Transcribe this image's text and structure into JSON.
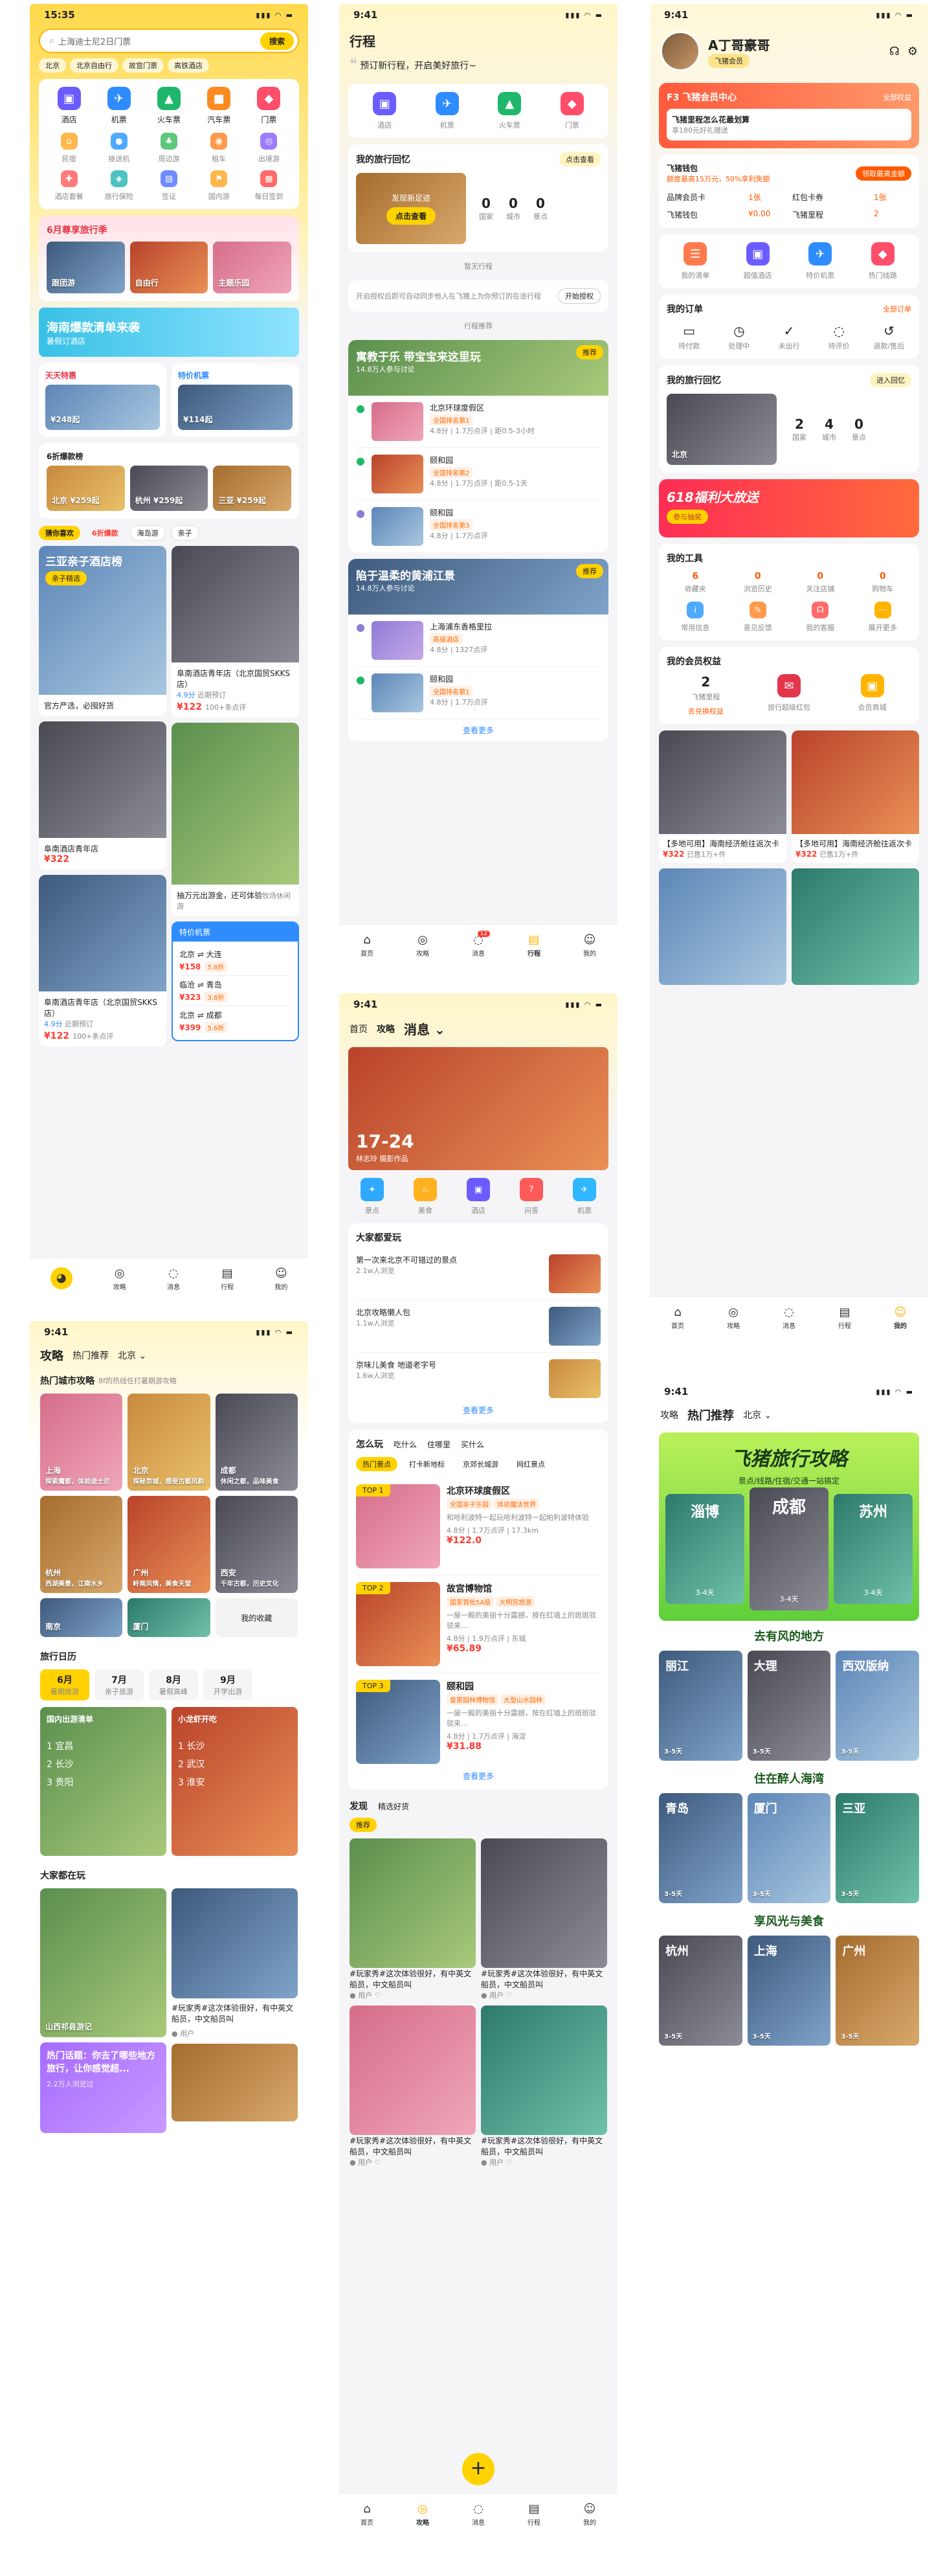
{
  "home": {
    "time": "15:35",
    "search_placeholder": "上海迪士尼2日门票",
    "search_btn": "搜索",
    "quick_tags": [
      "北京",
      "北京自由行",
      "故宫门票",
      "高铁酒店"
    ],
    "main_icons": [
      {
        "label": "酒店",
        "color": "#6a5cff"
      },
      {
        "label": "机票",
        "color": "#2f8cff"
      },
      {
        "label": "火车票",
        "color": "#1fb86a"
      },
      {
        "label": "汽车票",
        "color": "#ff8a1f"
      },
      {
        "label": "门票",
        "color": "#ff4d6a"
      }
    ],
    "sub_icons": [
      "民宿",
      "接送机",
      "周边游",
      "租车",
      "出境游",
      "酒店套餐",
      "旅行保险",
      "签证",
      "国内游",
      "每日签到"
    ],
    "promo_title": "6月尊享旅行季",
    "promo_items": [
      "跟团游",
      "自由行",
      "主题乐园"
    ],
    "banner_text": "海南爆款清单来袭",
    "banner_sub": "暑假订酒店",
    "deal_left_title": "天天特惠",
    "deal_left_sub": "¥248起",
    "deal_right_title": "特价机票",
    "deal_right_sub": "¥114起",
    "hotel_rank_title": "6折爆款榜",
    "hotel_rank": [
      {
        "name": "北京",
        "price": "¥259起"
      },
      {
        "name": "杭州",
        "price": "¥259起"
      },
      {
        "name": "三亚",
        "price": "¥259起"
      }
    ],
    "feed_tabs": [
      "猜你喜欢",
      "6折爆款",
      "海岛游",
      "亲子"
    ],
    "feed": [
      {
        "title": "三亚亲子酒店榜",
        "desc": "官方严选，必囤好货",
        "sub": "亲子精选"
      },
      {
        "title": "阜南酒店青年店（北京国贸SKKS店）",
        "score": "4.9分",
        "note": "近期预订",
        "price": "¥122",
        "sold": "100+条点评"
      },
      {
        "title": "阜南酒店青年店",
        "price": "¥322"
      },
      {
        "title": "抽万元出游金，还可体验",
        "desc": "牧场休闲游"
      },
      {
        "title": "阜南酒店青年店（北京国贸SKKS店）",
        "score": "4.9分",
        "note": "近期预订",
        "price": "¥122",
        "sold": "100+条点评"
      }
    ],
    "flights_title": "特价机票",
    "flights": [
      {
        "route": "北京 ⇌ 大连",
        "price": "¥158",
        "tag": "5.8折"
      },
      {
        "route": "临沧 ⇌ 青岛",
        "price": "¥323",
        "tag": "3.8折"
      },
      {
        "route": "北京 ⇌ 成都",
        "price": "¥399",
        "tag": "5.6折"
      }
    ],
    "tabs": [
      "",
      "攻略",
      "消息",
      "行程",
      "我的"
    ]
  },
  "trip": {
    "time": "9:41",
    "title": "行程",
    "hint": "预订新行程，开启美好旅行~",
    "icons": [
      "酒店",
      "机票",
      "火车票",
      "门票"
    ],
    "memory_title": "我的旅行回忆",
    "memory_btn": "点击查看",
    "memory_card": "发现新足迹",
    "memory_card_btn": "点击查看",
    "stats": [
      {
        "value": "0",
        "label": "国家"
      },
      {
        "value": "0",
        "label": "城市"
      },
      {
        "value": "0",
        "label": "景点"
      }
    ],
    "empty_label": "暂无行程",
    "auth_text": "开启授权后即可自动同步他人在飞猪上为你预订的在途行程",
    "auth_btn": "开始授权",
    "recommend_label": "行程推荐",
    "rec1_title": "寓教于乐 带宝宝来这里玩",
    "rec1_sub": "14.8万人参与讨论",
    "rec1_tag": "推荐",
    "rec1_items": [
      {
        "name": "北京环球度假区",
        "tag": "全国排名第1",
        "score": "4.8分",
        "reviews": "1.7万点评",
        "dist": "距0.5-3小时"
      },
      {
        "name": "颐和园",
        "tag": "全国排名第2",
        "score": "4.8分",
        "reviews": "1.7万点评",
        "dist": "距0.5-1天"
      },
      {
        "name": "颐和园",
        "tag": "全国排名第3",
        "score": "4.8分",
        "reviews": "1.7万点评",
        "dist": ""
      }
    ],
    "rec2_title": "陷于温柔的黄浦江景",
    "rec2_sub": "14.8万人参与讨论",
    "rec2_tag": "推荐",
    "rec2_items": [
      {
        "name": "上海浦东香格里拉",
        "tag": "高级酒店",
        "score": "4.8分",
        "reviews": "1327点评"
      },
      {
        "name": "颐和园",
        "tag": "全国排名第1",
        "score": "4.8分",
        "reviews": "1.7万点评"
      }
    ],
    "more": "查看更多",
    "tabs": [
      "首页",
      "攻略",
      "消息",
      "行程",
      "我的"
    ],
    "badge": "12"
  },
  "mine": {
    "time": "9:41",
    "username": "A丁哥豪哥",
    "level": "飞猪会员",
    "member_card": "F3 飞猪会员中心",
    "member_link": "全部权益",
    "member_tip": "飞猪里程怎么花最划算",
    "member_tip_sub": "享180元好礼赠送",
    "wallet_title": "飞猪钱包",
    "wallet_sub": "额度最高15万元，50%享利免额",
    "wallet_btn": "领取最高金额",
    "wallet_rows": [
      [
        "品牌会员卡",
        "1张",
        "红包卡券",
        "1张"
      ],
      [
        "飞猪钱包",
        "¥0.00",
        "飞猪里程",
        "2"
      ]
    ],
    "quick": [
      "我的清单",
      "超值酒店",
      "特价机票",
      "热门线路"
    ],
    "orders_title": "我的订单",
    "orders_link": "全部订单",
    "orders": [
      "待付款",
      "处理中",
      "未出行",
      "待评价",
      "退款/售后"
    ],
    "memory_title": "我的旅行回忆",
    "memory_link": "进入回忆",
    "memory_stats": [
      {
        "value": "2",
        "label": "国家"
      },
      {
        "value": "4",
        "label": "城市"
      },
      {
        "value": "0",
        "label": "景点"
      }
    ],
    "memory_place": "北京",
    "banner_title": "618福利大放送",
    "banner_btn": "参与抽奖",
    "tools_title": "我的工具",
    "tools_stats": [
      {
        "value": "6",
        "label": "收藏夹"
      },
      {
        "value": "0",
        "label": "浏览历史"
      },
      {
        "value": "0",
        "label": "关注店铺"
      },
      {
        "value": "0",
        "label": "购物车"
      }
    ],
    "tools": [
      "常用信息",
      "意见反馈",
      "我的客服",
      "展开更多"
    ],
    "vip_title": "我的会员权益",
    "vip_items": [
      {
        "label": "飞猪里程",
        "value": "2"
      },
      {
        "label": "旅行超级红包",
        "value": ""
      },
      {
        "label": "会员商城",
        "value": ""
      }
    ],
    "vip_link": "去兑换权益",
    "products": [
      {
        "title": "【多地可用】海南经济舱往返次卡",
        "price": "¥322",
        "note": "已售1万+件"
      },
      {
        "title": "【多地可用】海南经济舱往返次卡",
        "price": "¥322",
        "note": "已售1万+件"
      }
    ],
    "tabs": [
      "首页",
      "攻略",
      "消息",
      "行程",
      "我的"
    ]
  },
  "guide": {
    "time": "9:41",
    "tabs": [
      "攻略",
      "热门推荐",
      "北京"
    ],
    "hot_title": "热门城市攻略",
    "hot_sub": "8f的热线任打暑期游攻略",
    "cities": [
      {
        "name": "上海",
        "desc": "探索魔都，体验迪士尼"
      },
      {
        "name": "北京",
        "desc": "探秘京城，感受古都风韵"
      },
      {
        "name": "成都",
        "desc": "休闲之都，品味美食"
      },
      {
        "name": "杭州",
        "desc": "西湖美景，江南水乡"
      },
      {
        "name": "广州",
        "desc": "岭南风情，美食天堂"
      },
      {
        "name": "西安",
        "desc": "千年古都，历史文化"
      },
      {
        "name": "南京",
        "desc": "六朝古都"
      },
      {
        "name": "厦门",
        "desc": "海上花园"
      },
      {
        "name": "我的收藏",
        "desc": ""
      }
    ],
    "cal_title": "旅行日历",
    "months": [
      {
        "m": "6月",
        "s": "暑期旅游"
      },
      {
        "m": "7月",
        "s": "亲子旅游"
      },
      {
        "m": "8月",
        "s": "暑假高峰"
      },
      {
        "m": "9月",
        "s": "开学出游"
      }
    ],
    "cal_cards": [
      {
        "title": "国内出游清单",
        "items": [
          "宜昌",
          "长沙",
          "贵阳"
        ]
      },
      {
        "title": "小龙虾开吃",
        "items": [
          "长沙",
          "武汉",
          "淮安"
        ]
      }
    ],
    "play_title": "大家都在玩",
    "plays": [
      {
        "title": "山西祁县游记",
        "user": "用户"
      },
      {
        "title": "#玩家秀#这次体验很好，有中英文船员，中文船员叫",
        "user": "用户"
      }
    ],
    "question": "热门话题：你去了哪些地方旅行，让你感觉超...",
    "question_sub": "2.2万人浏览过"
  },
  "beijing": {
    "time": "9:41",
    "tabs": [
      "首页",
      "攻略",
      "消息",
      "行程",
      "我的"
    ],
    "hero_date": "17-24",
    "hero_caption": "林志玲 摄影作品",
    "icons": [
      {
        "label": "景点",
        "color": "#2fa9ff"
      },
      {
        "label": "美食",
        "color": "#ffb21f"
      },
      {
        "label": "酒店",
        "color": "#6a5cff"
      },
      {
        "label": "问答",
        "color": "#ff5a5a"
      },
      {
        "label": "机票",
        "color": "#2fb8ff"
      }
    ],
    "love_title": "大家都爱玩",
    "loves": [
      {
        "title": "第一次来北京不可错过的景点",
        "sub": "2.1w人浏览"
      },
      {
        "title": "北京攻略懒人包",
        "sub": "1.1w人浏览"
      },
      {
        "title": "京味儿美食 地道老字号",
        "sub": "1.6w人浏览"
      }
    ],
    "more": "查看更多",
    "how_tabs": [
      "怎么玩",
      "吃什么",
      "住哪里",
      "买什么"
    ],
    "how_sub": [
      "热门景点",
      "打卡新地标",
      "京郊长城游",
      "网红景点"
    ],
    "spots": [
      {
        "rank": "TOP 1",
        "name": "北京环球度假区",
        "tags": [
          "全国亲子乐园",
          "体验魔法世界"
        ],
        "desc": "和哈利波特一起玩哈利波特一起帕利波特体验",
        "score": "4.8分",
        "reviews": "1.7万点评",
        "dist": "17.3km",
        "price": "¥122.0"
      },
      {
        "rank": "TOP 2",
        "name": "故宫博物馆",
        "tags": [
          "国家首批5A级",
          "大明宫旅游"
        ],
        "desc": "一屋一殿的美丽十分震撼，按在红墙上的斑斑驳驳来...",
        "score": "4.8分",
        "reviews": "1.9万点评",
        "dist": "东城",
        "price": "¥65.89"
      },
      {
        "rank": "TOP 3",
        "name": "颐和园",
        "tags": [
          "皇家园林博物馆",
          "大型山水园林"
        ],
        "desc": "一屋一殿的美丽十分震撼，按在红墙上的斑斑驳驳来...",
        "score": "4.8分",
        "reviews": "1.7万点评",
        "dist": "海淀",
        "price": "¥31.88"
      }
    ],
    "find_tabs": [
      "发现",
      "精选好货"
    ],
    "find_pill": "推荐",
    "posts": [
      {
        "title": "#玩家秀#这次体验很好，有中英文船员，中文船员叫",
        "user": "用户"
      },
      {
        "title": "#玩家秀#这次体验很好，有中英文船员，中文船员叫",
        "user": "用户"
      },
      {
        "title": "#玩家秀#这次体验很好，有中英文船员，中文船员叫",
        "user": "用户"
      },
      {
        "title": "#玩家秀#这次体验很好，有中英文船员，中文船员叫",
        "user": "用户"
      }
    ]
  },
  "poster": {
    "time": "9:41",
    "tabs": [
      "攻略",
      "热门推荐",
      "北京"
    ],
    "title": "飞猪旅行攻略",
    "sub": "景点/线路/住宿/交通一站搞定",
    "top3": [
      {
        "name": "淄博",
        "days": "3-4天"
      },
      {
        "name": "成都",
        "days": "3-4天"
      },
      {
        "name": "苏州",
        "days": "3-4天"
      }
    ],
    "sections": [
      {
        "title": "去有风的地方",
        "cities": [
          {
            "name": "丽江",
            "days": "3-5天"
          },
          {
            "name": "大理",
            "days": "3-5天"
          },
          {
            "name": "西双版纳",
            "days": "3-5天"
          }
        ]
      },
      {
        "title": "住在醉人海湾",
        "cities": [
          {
            "name": "青岛",
            "days": "3-5天"
          },
          {
            "name": "厦门",
            "days": "3-5天"
          },
          {
            "name": "三亚",
            "days": "3-5天"
          }
        ]
      },
      {
        "title": "享风光与美食",
        "cities": [
          {
            "name": "杭州",
            "days": "3-5天"
          },
          {
            "name": "上海",
            "days": "3-5天"
          },
          {
            "name": "广州",
            "days": "3-5天"
          }
        ]
      }
    ]
  }
}
